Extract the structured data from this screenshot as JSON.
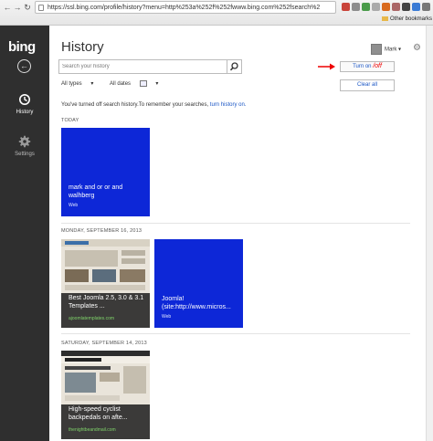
{
  "browser": {
    "url": "https://ssl.bing.com/profile/history?menu=http%253a%252f%252fwww.bing.com%252fsearch%2",
    "other_bookmarks": "Other bookmarks",
    "colors": {
      "chrome": "#e6e6e6"
    }
  },
  "rail": {
    "logo": "bing",
    "history_label": "History",
    "settings_label": "Settings"
  },
  "header": {
    "title": "History",
    "user_name": "Mark",
    "search_placeholder": "Search your history",
    "turn_on_label": "Turn on",
    "turn_off_annotation": "/off",
    "clear_all_label": "Clear all"
  },
  "filters": {
    "type": "All types",
    "dates": "All dates"
  },
  "notice": {
    "text": "You've turned off search history.To remember your searches,",
    "link": "turn history on."
  },
  "sections": [
    {
      "date": "TODAY",
      "tiles": [
        {
          "title": "mark and or or and walhberg",
          "source": "Web"
        }
      ]
    },
    {
      "date": "MONDAY, SEPTEMBER 16, 2013",
      "tiles": [
        {
          "title": "Best Joomla 2.5, 3.0 & 3.1 Templates ...",
          "url": "ajoomlatemplates.com"
        },
        {
          "title": "Joomla! (site:http://www.micros...",
          "source": "Web"
        }
      ]
    },
    {
      "date": "SATURDAY, SEPTEMBER 14, 2013",
      "tiles": [
        {
          "title": "High-speed cyclist backpedals on afte...",
          "url": "thenightbeandmail.com"
        }
      ]
    }
  ],
  "colors": {
    "tile_blue": "#0d27d7",
    "rail": "#2f2f2f",
    "link": "#1a56c5",
    "annotation": "#e00000"
  }
}
